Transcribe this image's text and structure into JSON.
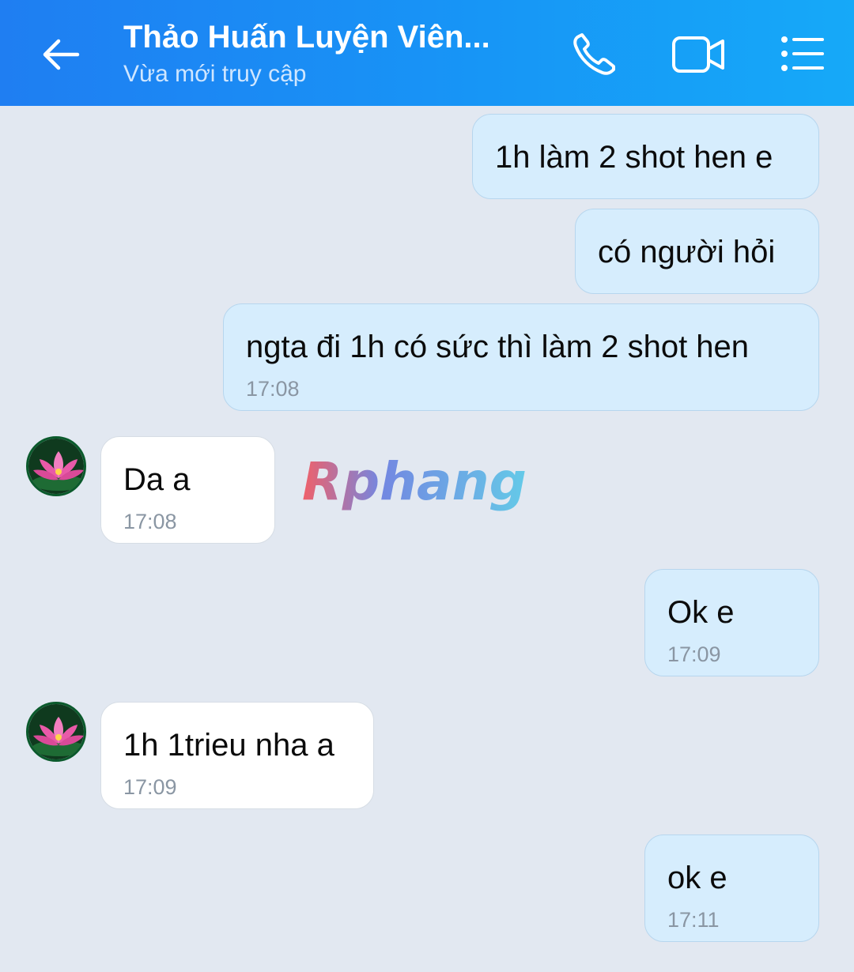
{
  "header": {
    "title": "Thảo Huấn Luyện Viên...",
    "subtitle": "Vừa mới truy cập",
    "icons": {
      "back": "back-arrow-icon",
      "call": "phone-icon",
      "video": "video-camera-icon",
      "menu": "list-menu-icon"
    },
    "accent": "#1f7ef2"
  },
  "messages": [
    {
      "direction": "out",
      "text": "1h làm 2 shot hen e",
      "time": ""
    },
    {
      "direction": "out",
      "text": "có người hỏi",
      "time": ""
    },
    {
      "direction": "out",
      "text": "ngta đi 1h có sức thì làm 2 shot hen",
      "time": "17:08"
    },
    {
      "direction": "in",
      "text": "Da a",
      "time": "17:08"
    },
    {
      "direction": "out",
      "text": "Ok e",
      "time": "17:09"
    },
    {
      "direction": "in",
      "text": "1h 1trieu nha a",
      "time": "17:09"
    },
    {
      "direction": "out",
      "text": "ok e",
      "time": "17:11"
    }
  ],
  "watermark": {
    "text": "Rphang"
  },
  "colors": {
    "background": "#e2e8f1",
    "outgoing_bubble": "#d6edfd",
    "incoming_bubble": "#ffffff"
  }
}
